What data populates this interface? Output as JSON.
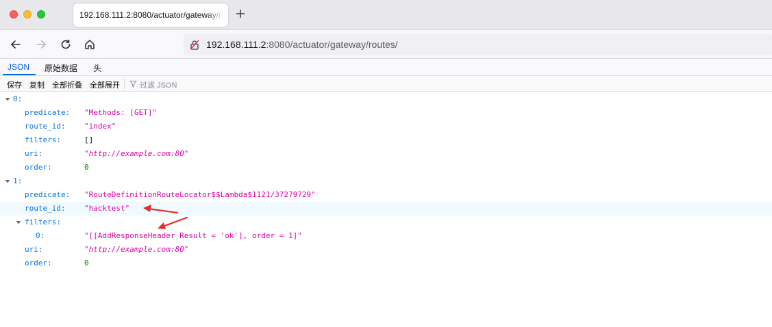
{
  "browser": {
    "tab_title": "192.168.111.2:8080/actuator/gateway/routes/",
    "url_host": "192.168.111.2",
    "url_rest": ":8080/actuator/gateway/routes/"
  },
  "viewer": {
    "tabs": [
      {
        "label": "JSON"
      },
      {
        "label": "原始数据"
      },
      {
        "label": "头"
      }
    ],
    "toolbar": {
      "save": "保存",
      "copy": "复制",
      "collapse_all": "全部折叠",
      "expand_all": "全部展开",
      "filter_placeholder": "过滤 JSON"
    }
  },
  "json": [
    {
      "index": "0:",
      "predicate_key": "predicate:",
      "predicate": "\"Methods: [GET]\"",
      "route_id_key": "route_id:",
      "route_id": "\"index\"",
      "filters_key": "filters:",
      "filters": "[]",
      "uri_key": "uri:",
      "uri": "\"http://example.com:80\"",
      "order_key": "order:",
      "order": "0"
    },
    {
      "index": "1:",
      "predicate_key": "predicate:",
      "predicate": "\"RouteDefinitionRouteLocator$$Lambda$1121/37279729\"",
      "route_id_key": "route_id:",
      "route_id": "\"hacktest\"",
      "filters_key": "filters:",
      "filter_items": [
        {
          "index": "0:",
          "value": "\"[[AddResponseHeader Result = 'ok'], order = 1]\""
        }
      ],
      "uri_key": "uri:",
      "uri": "\"http://example.com:80\"",
      "order_key": "order:",
      "order": "0"
    }
  ],
  "colors": {
    "key": "#0074e8",
    "string": "#dd00a9",
    "number": "#058b00",
    "annotation_arrow": "#e0302a"
  }
}
